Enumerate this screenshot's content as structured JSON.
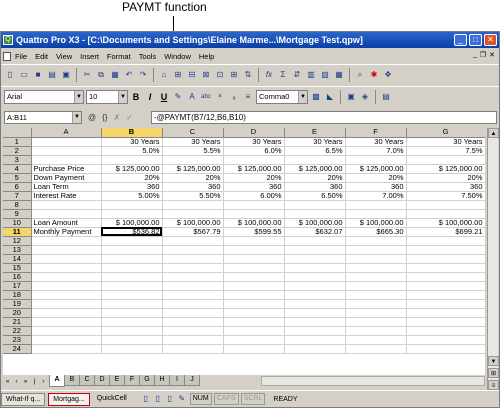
{
  "callout": "PAYMT function",
  "window": {
    "title": "Quattro Pro X3 - [C:\\Documents and Settings\\Elaine Marme...\\Mortgage Test.qpw]"
  },
  "menu": [
    "File",
    "Edit",
    "View",
    "Insert",
    "Format",
    "Tools",
    "Window",
    "Help"
  ],
  "toolbar2": {
    "font": "Arial",
    "size": "10",
    "bold": "B",
    "italic": "I",
    "underline": "U",
    "style": "Comma0"
  },
  "input_line": {
    "cell_ref": "A:B11",
    "formula": "-@PAYMT(B7/12,B6,B10)"
  },
  "sheet": {
    "columns": [
      "A",
      "B",
      "C",
      "D",
      "E",
      "F",
      "G"
    ],
    "selected_column": "B",
    "selected_row": "11",
    "rows": [
      {
        "n": "1",
        "cells": [
          "",
          "30 Years",
          "30 Years",
          "30 Years",
          "30 Years",
          "30 Years",
          "30 Years"
        ]
      },
      {
        "n": "2",
        "cells": [
          "",
          "5.0%",
          "5.5%",
          "6.0%",
          "6.5%",
          "7.0%",
          "7.5%"
        ]
      },
      {
        "n": "3",
        "cells": [
          "",
          "",
          "",
          "",
          "",
          "",
          ""
        ]
      },
      {
        "n": "4",
        "cells": [
          "Purchase Price",
          "$  125,000.00",
          "$  125,000.00",
          "$  125,000.00",
          "$  125,000.00",
          "$  125,000.00",
          "$  125,000.00"
        ]
      },
      {
        "n": "5",
        "cells": [
          "Down Payment",
          "20%",
          "20%",
          "20%",
          "20%",
          "20%",
          "20%"
        ]
      },
      {
        "n": "6",
        "cells": [
          "Loan Term",
          "360",
          "360",
          "360",
          "360",
          "360",
          "360"
        ]
      },
      {
        "n": "7",
        "cells": [
          "Interest Rate",
          "5.00%",
          "5.50%",
          "6.00%",
          "6.50%",
          "7.00%",
          "7.50%"
        ]
      },
      {
        "n": "8",
        "cells": [
          "",
          "",
          "",
          "",
          "",
          "",
          ""
        ]
      },
      {
        "n": "9",
        "cells": [
          "",
          "",
          "",
          "",
          "",
          "",
          ""
        ]
      },
      {
        "n": "10",
        "cells": [
          "Loan Amount",
          "$  100,000.00",
          "$  100,000.00",
          "$  100,000.00",
          "$  100,000.00",
          "$  100,000.00",
          "$  100,000.00"
        ]
      },
      {
        "n": "11",
        "cells": [
          "Monthly Payment",
          "$536.82",
          "$567.79",
          "$599.55",
          "$632.07",
          "$665.30",
          "$699.21"
        ]
      },
      {
        "n": "12",
        "cells": [
          "",
          "",
          "",
          "",
          "",
          "",
          ""
        ]
      },
      {
        "n": "13",
        "cells": [
          "",
          "",
          "",
          "",
          "",
          "",
          ""
        ]
      },
      {
        "n": "14",
        "cells": [
          "",
          "",
          "",
          "",
          "",
          "",
          ""
        ]
      },
      {
        "n": "15",
        "cells": [
          "",
          "",
          "",
          "",
          "",
          "",
          ""
        ]
      },
      {
        "n": "16",
        "cells": [
          "",
          "",
          "",
          "",
          "",
          "",
          ""
        ]
      },
      {
        "n": "17",
        "cells": [
          "",
          "",
          "",
          "",
          "",
          "",
          ""
        ]
      },
      {
        "n": "18",
        "cells": [
          "",
          "",
          "",
          "",
          "",
          "",
          ""
        ]
      },
      {
        "n": "19",
        "cells": [
          "",
          "",
          "",
          "",
          "",
          "",
          ""
        ]
      },
      {
        "n": "20",
        "cells": [
          "",
          "",
          "",
          "",
          "",
          "",
          ""
        ]
      },
      {
        "n": "21",
        "cells": [
          "",
          "",
          "",
          "",
          "",
          "",
          ""
        ]
      },
      {
        "n": "22",
        "cells": [
          "",
          "",
          "",
          "",
          "",
          "",
          ""
        ]
      },
      {
        "n": "23",
        "cells": [
          "",
          "",
          "",
          "",
          "",
          "",
          ""
        ]
      },
      {
        "n": "24",
        "cells": [
          "",
          "",
          "",
          "",
          "",
          "",
          ""
        ]
      }
    ]
  },
  "sheet_tabs": [
    "A",
    "B",
    "C",
    "D",
    "E",
    "F",
    "G",
    "H",
    "I",
    "J"
  ],
  "active_tab": "A",
  "taskbar": {
    "items": [
      "What-If q...",
      "Mortgag...",
      "QuickCell"
    ],
    "indicators": [
      "NUM",
      "CAPS",
      "SCRL"
    ],
    "status": "READY"
  }
}
